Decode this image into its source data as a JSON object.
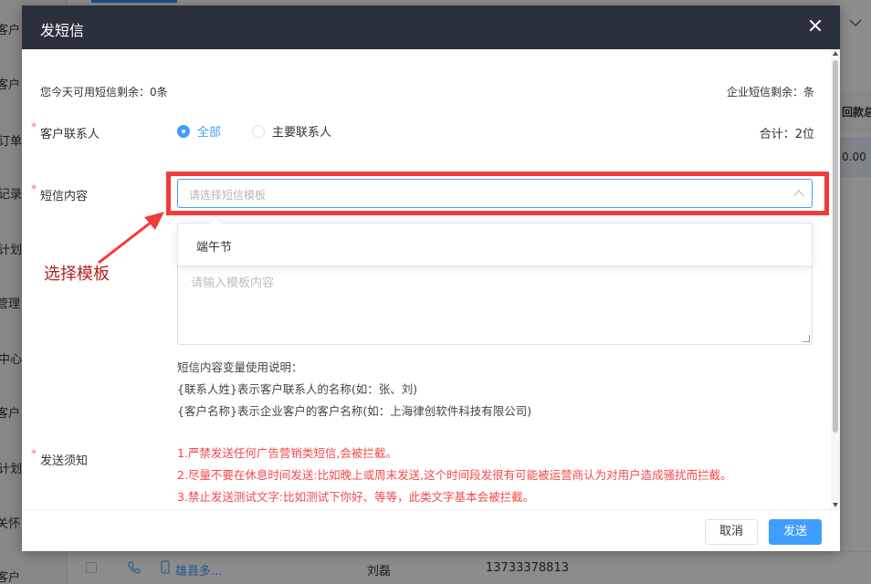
{
  "background": {
    "sidebar_items": [
      "客户",
      "客户",
      "订单",
      "记录",
      "计划",
      "管理",
      "中心",
      "客户",
      "计划",
      "关怀",
      "客户"
    ],
    "right_column_header": "回款总",
    "right_column_value": "0.00",
    "bottom_row": {
      "company": "雄县多...",
      "contact": "刘磊",
      "phone": "13733378813"
    }
  },
  "dialog": {
    "title": "发短信",
    "daily_remaining": "您今天可用短信剩余：0条",
    "company_remaining": "企业短信剩余：条",
    "contact_label": "客户联系人",
    "radio_all": "全部",
    "radio_main": "主要联系人",
    "total": "合计：2位",
    "content_label": "短信内容",
    "select_placeholder": "请选择短信模板",
    "dropdown_option": "端午节",
    "textarea_placeholder": "请输入模板内容",
    "hints": [
      "短信内容变量使用说明：",
      "{联系人姓}表示客户联系人的名称(如：张、刘)",
      "{客户名称}表示企业客户的客户名称(如：上海律创软件科技有限公司)"
    ],
    "notice_label": "发送须知",
    "notices": [
      "1.严禁发送任何广告营销类短信,会被拦截。",
      "2.尽量不要在休息时间发送:比如晚上或周末发送,这个时间段发很有可能被运营商认为对用户造成骚扰而拦截。",
      "3.禁止发送测试文字:比如测试下你好、等等，此类文字基本会被拦截。"
    ],
    "cancel_label": "取消",
    "send_label": "发送",
    "required_mark": "*"
  },
  "annotation": {
    "text": "选择模板",
    "color": "#b22222",
    "highlight_color": "#f23a3a"
  }
}
